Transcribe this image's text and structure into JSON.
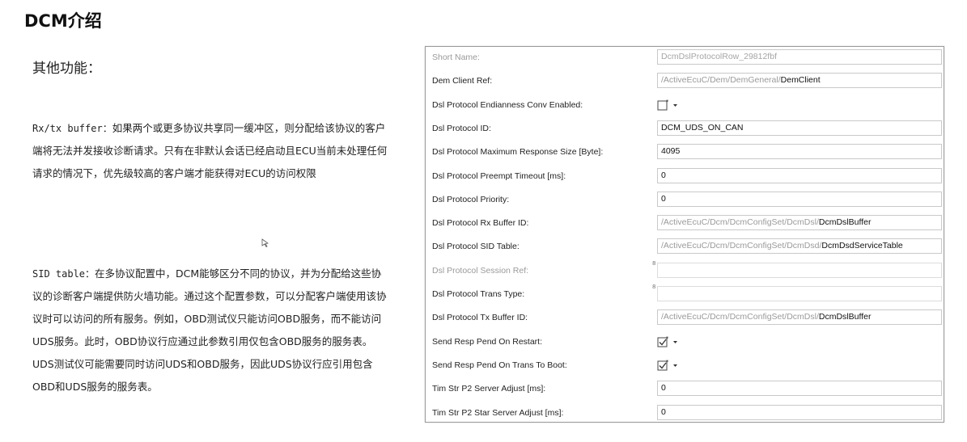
{
  "header": {
    "title": "DCM介绍"
  },
  "left": {
    "subtitle": "其他功能：",
    "rx": {
      "term": "Rx/tx buffer：",
      "text": "如果两个或更多协议共享同一缓冲区，则分配给该协议的客户端将无法并发接收诊断请求。只有在非默认会话已经启动且ECU当前未处理任何请求的情况下，优先级较高的客户端才能获得对ECU的访问权限"
    },
    "sid": {
      "term": "SID table：",
      "text": "在多协议配置中，DCM能够区分不同的协议，并为分配给这些协议的诊断客户端提供防火墙功能。通过这个配置参数，可以分配客户端使用该协议时可以访问的所有服务。例如，OBD测试仪只能访问OBD服务，而不能访问UDS服务。此时，OBD协议行应通过此参数引用仅包含OBD服务的服务表。UDS测试仪可能需要同时访问UDS和OBD服务，因此UDS协议行应引用包含OBD和UDS服务的服务表。"
    }
  },
  "config": {
    "rows": [
      {
        "label": "Short Name:",
        "value": "DcmDslProtocolRow_29812fbf",
        "type": "text",
        "disabled": true
      },
      {
        "label": "Dem Client Ref:",
        "path": "/ActiveEcuC/Dem/DemGeneral/",
        "leaf": "DemClient",
        "type": "ref"
      },
      {
        "label": "Dsl Protocol Endianness Conv Enabled:",
        "type": "check",
        "checked": false
      },
      {
        "label": "Dsl Protocol ID:",
        "value": "DCM_UDS_ON_CAN",
        "type": "text"
      },
      {
        "label": "Dsl Protocol Maximum Response Size [Byte]:",
        "value": "4095",
        "type": "text"
      },
      {
        "label": "Dsl Protocol Preempt Timeout [ms]:",
        "value": "0",
        "type": "text"
      },
      {
        "label": "Dsl Protocol Priority:",
        "value": "0",
        "type": "text"
      },
      {
        "label": "Dsl Protocol Rx Buffer ID:",
        "path": "/ActiveEcuC/Dcm/DcmConfigSet/DcmDsl/",
        "leaf": "DcmDslBuffer",
        "type": "ref"
      },
      {
        "label": "Dsl Protocol SID Table:",
        "path": "/ActiveEcuC/Dcm/DcmConfigSet/DcmDsd/",
        "leaf": "DcmDsdServiceTable",
        "type": "ref"
      },
      {
        "label": "Dsl Protocol Session Ref:",
        "type": "empty",
        "disabled": true,
        "marker": "8"
      },
      {
        "label": "Dsl Protocol Trans Type:",
        "type": "empty",
        "marker": "8"
      },
      {
        "label": "Dsl Protocol Tx Buffer ID:",
        "path": "/ActiveEcuC/Dcm/DcmConfigSet/DcmDsl/",
        "leaf": "DcmDslBuffer",
        "type": "ref"
      },
      {
        "label": "Send Resp Pend On Restart:",
        "type": "check",
        "checked": true
      },
      {
        "label": "Send Resp Pend On Trans To Boot:",
        "type": "check",
        "checked": true
      },
      {
        "label": "Tim Str P2 Server Adjust [ms]:",
        "value": "0",
        "type": "text"
      },
      {
        "label": "Tim Str P2 Star Server Adjust [ms]:",
        "value": "0",
        "type": "text"
      }
    ]
  },
  "colors": {
    "panel_border": "#9a9a9a",
    "field_border": "#c9c9c9",
    "disabled_text": "#9a9a9a"
  },
  "icons": {
    "checkbox_icon": "checkbox-with-dropdown-icon",
    "cursor_icon": "mouse-cursor-icon"
  }
}
